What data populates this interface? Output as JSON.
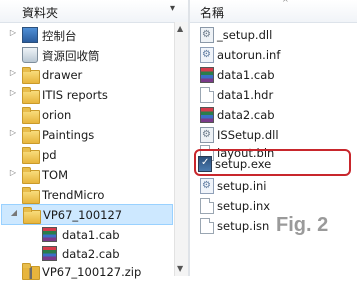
{
  "left_pane": {
    "header": "資料夾",
    "items": [
      {
        "label": "控制台",
        "icon": "control-panel-icon",
        "indent": 0,
        "expander": "▷"
      },
      {
        "label": "資源回收筒",
        "icon": "recycle-bin-icon",
        "indent": 0,
        "expander": ""
      },
      {
        "label": "drawer",
        "icon": "folder-icon",
        "indent": 0,
        "expander": "▷"
      },
      {
        "label": "ITIS reports",
        "icon": "folder-icon",
        "indent": 0,
        "expander": "▷"
      },
      {
        "label": "orion",
        "icon": "folder-icon",
        "indent": 0,
        "expander": ""
      },
      {
        "label": "Paintings",
        "icon": "folder-icon",
        "indent": 0,
        "expander": "▷"
      },
      {
        "label": "pd",
        "icon": "folder-icon",
        "indent": 0,
        "expander": ""
      },
      {
        "label": "TOM",
        "icon": "folder-icon",
        "indent": 0,
        "expander": "▷"
      },
      {
        "label": "TrendMicro",
        "icon": "folder-icon",
        "indent": 0,
        "expander": ""
      },
      {
        "label": "VP67_100127",
        "icon": "folder-icon",
        "indent": 0,
        "expander": "◢",
        "selected": true
      },
      {
        "label": "data1.cab",
        "icon": "cab-icon",
        "indent": 1,
        "expander": ""
      },
      {
        "label": "data2.cab",
        "icon": "cab-icon",
        "indent": 1,
        "expander": ""
      },
      {
        "label": "VP67_100127.zip",
        "icon": "zip-folder-icon",
        "indent": 0,
        "expander": ""
      }
    ]
  },
  "right_pane": {
    "header": "名稱",
    "files": [
      {
        "label": "_setup.dll",
        "icon": "dll-icon"
      },
      {
        "label": "autorun.inf",
        "icon": "ini-icon"
      },
      {
        "label": "data1.cab",
        "icon": "cab-icon"
      },
      {
        "label": "data1.hdr",
        "icon": "doc-icon"
      },
      {
        "label": "data2.cab",
        "icon": "cab-icon"
      },
      {
        "label": "ISSetup.dll",
        "icon": "dll-icon"
      },
      {
        "label": "layout.bin",
        "icon": "doc-icon"
      },
      {
        "label": "setup.exe",
        "icon": "exe-icon",
        "highlighted": true
      },
      {
        "label": "setup.ini",
        "icon": "ini-icon"
      },
      {
        "label": "setup.inx",
        "icon": "doc-icon"
      },
      {
        "label": "setup.isn",
        "icon": "doc-icon"
      }
    ]
  },
  "figure_label": "Fig. 2",
  "colors": {
    "highlight": "#c8262c",
    "selection": "#cde8ff",
    "figure_label": "#9a9a9a"
  }
}
